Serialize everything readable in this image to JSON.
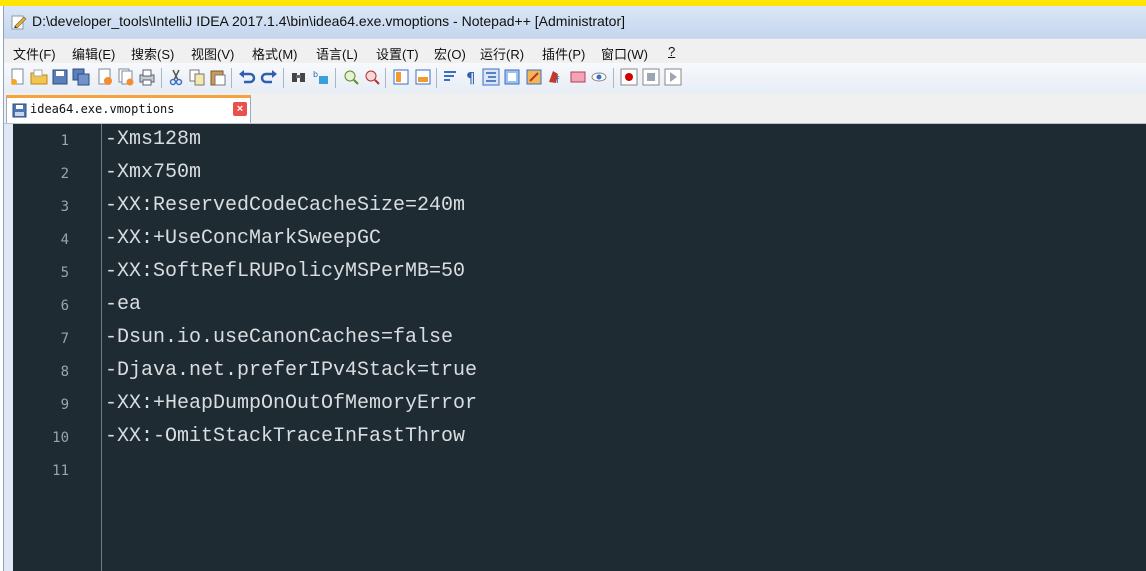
{
  "window": {
    "title": "D:\\developer_tools\\IntelliJ IDEA 2017.1.4\\bin\\idea64.exe.vmoptions - Notepad++ [Administrator]"
  },
  "menu": {
    "items": [
      "文件(F)",
      "编辑(E)",
      "搜索(S)",
      "视图(V)",
      "格式(M)",
      "语言(L)",
      "设置(T)",
      "宏(O)",
      "运行(R)",
      "插件(P)",
      "窗口(W)",
      "?"
    ]
  },
  "toolbar": {
    "icons": [
      "new-file-icon",
      "open-file-icon",
      "save-icon",
      "save-all-icon",
      "close-icon",
      "close-all-icon",
      "print-icon",
      "cut-icon",
      "copy-icon",
      "paste-icon",
      "undo-icon",
      "redo-icon",
      "find-icon",
      "replace-icon",
      "zoom-in-icon",
      "zoom-out-icon",
      "sync-vertical-icon",
      "sync-horizontal-icon",
      "word-wrap-icon",
      "show-all-chars-icon",
      "indent-guide-icon",
      "doc-map-icon",
      "function-list-icon",
      "folder-workspace-icon",
      "monitor-icon",
      "eye-icon",
      "record-macro-icon",
      "stop-record-icon",
      "play-macro-icon"
    ]
  },
  "tab": {
    "label": "idea64.exe.vmoptions",
    "close": "×"
  },
  "editor": {
    "lines": [
      {
        "num": "1",
        "text": "-Xms128m"
      },
      {
        "num": "2",
        "text": "-Xmx750m"
      },
      {
        "num": "3",
        "text": "-XX:ReservedCodeCacheSize=240m"
      },
      {
        "num": "4",
        "text": "-XX:+UseConcMarkSweepGC"
      },
      {
        "num": "5",
        "text": "-XX:SoftRefLRUPolicyMSPerMB=50"
      },
      {
        "num": "6",
        "text": "-ea"
      },
      {
        "num": "7",
        "text": "-Dsun.io.useCanonCaches=false"
      },
      {
        "num": "8",
        "text": "-Djava.net.preferIPv4Stack=true"
      },
      {
        "num": "9",
        "text": "-XX:+HeapDumpOnOutOfMemoryError"
      },
      {
        "num": "10",
        "text": "-XX:-OmitStackTraceInFastThrow"
      },
      {
        "num": "11",
        "text": ""
      }
    ]
  },
  "colors": {
    "editor_bg": "#1e2b33",
    "code_text": "#d9dde0",
    "line_number": "#9aa5ad",
    "tab_accent": "#f6a33b",
    "top_strip": "#ffe600"
  }
}
